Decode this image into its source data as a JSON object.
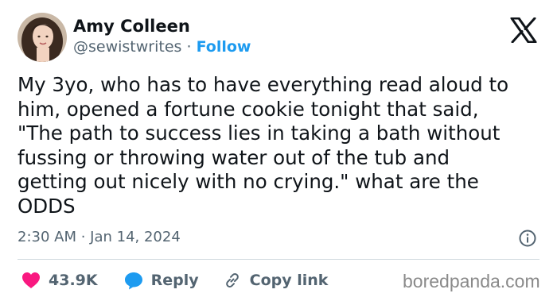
{
  "author": {
    "name": "Amy Colleen",
    "handle": "@sewistwrites",
    "separator": "·",
    "follow_label": "Follow"
  },
  "tweet": {
    "lines": [
      "My 3yo, who has to have everything read aloud to",
      "him, opened a fortune cookie tonight that said,",
      "\"The path to success lies in taking a bath without",
      "fussing or throwing water out of the tub and",
      "getting out nicely with no crying.\" what are the",
      "ODDS"
    ],
    "timestamp": "2:30 AM · Jan 14, 2024"
  },
  "actions": {
    "likes": "43.9K",
    "reply_label": "Reply",
    "copy_link_label": "Copy link"
  },
  "watermark": "boredpanda.com",
  "icons": {
    "logo": "x-logo-icon",
    "info": "info-icon",
    "like": "heart-icon",
    "reply": "reply-bubble-icon",
    "copy": "link-icon"
  },
  "colors": {
    "text": "#0f1419",
    "secondary": "#536471",
    "accent": "#1d9bf0",
    "like": "#f91880",
    "divider": "#cfd9de"
  }
}
